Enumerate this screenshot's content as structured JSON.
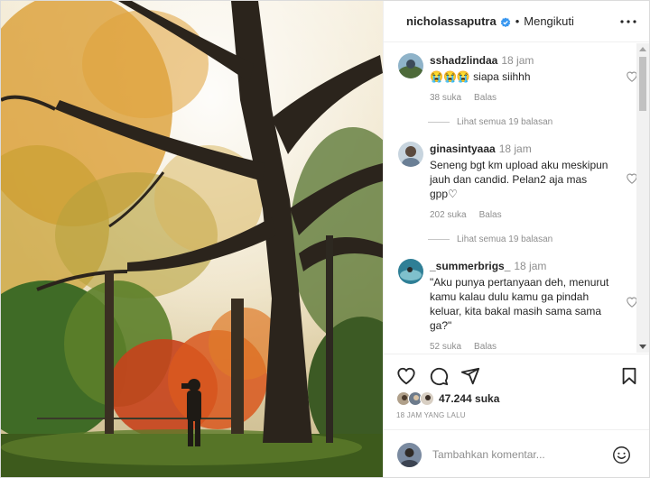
{
  "post": {
    "image_alt": "Foto pohon besar musim gugur dengan siluet fotografer",
    "username": "nicholassaputra",
    "verified": true,
    "separator": "•",
    "follow_status": "Mengikuti"
  },
  "comments": [
    {
      "username": "sshadzlindaa",
      "time": "18 jam",
      "text": "😭😭😭 siapa siihhh",
      "likes": "38 suka",
      "reply": "Balas",
      "view_replies": "Lihat semua 19 balasan",
      "avatar_color": "#4a6b8a"
    },
    {
      "username": "ginasintyaaa",
      "time": "18 jam",
      "text": "Seneng bgt km upload aku meskipun jauh dan candid. Pelan2 aja mas gpp♡",
      "likes": "202 suka",
      "reply": "Balas",
      "view_replies": "Lihat semua 19 balasan",
      "avatar_color": "#6a7f95"
    },
    {
      "username": "_summerbrigs_",
      "time": "18 jam",
      "text": "\"Aku punya pertanyaan deh, menurut kamu kalau dulu kamu ga pindah keluar, kita bakal masih sama sama ga?\"",
      "likes": "52 suka",
      "reply": "Balas",
      "avatar_color": "#3b8aa0"
    }
  ],
  "actions": {
    "icons": [
      "heart-icon",
      "comment-icon",
      "share-icon",
      "bookmark-icon"
    ],
    "likes_count": "47.244 suka",
    "post_time": "18 JAM YANG LALU"
  },
  "add_comment": {
    "placeholder": "Tambahkan komentar...",
    "emoji_icon": "smiley-icon"
  },
  "colors": {
    "verified_blue": "#3897f0",
    "text": "#262626",
    "muted": "#8e8e8e",
    "border": "#efefef"
  }
}
